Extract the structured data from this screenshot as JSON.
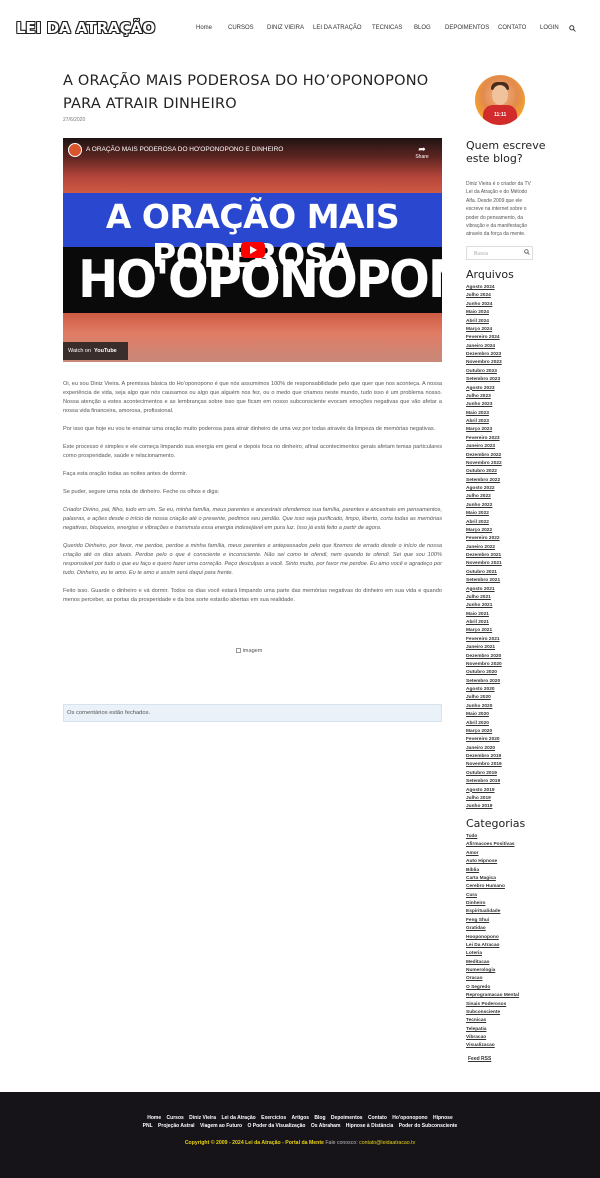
{
  "header": {
    "logo": "LEI DA ATRAÇÃO",
    "nav": [
      "Home",
      "CURSOS",
      "DINIZ VIEIRA",
      "LEI DA ATRAÇÃO",
      "TECNICAS",
      "BLOG",
      "DEPOIMENTOS",
      "CONTATO",
      "LOGIN"
    ]
  },
  "post": {
    "title": "A ORAÇÃO MAIS PODEROSA DO HO’OPONOPONO PARA ATRAIR DINHEIRO",
    "date": "27/6/2020",
    "video": {
      "title": "A ORAÇÃO MAIS PODEROSA DO HO'OPONOPONO E DINHEIRO",
      "share": "Share",
      "line1": "A ORAÇÃO MAIS PODEROSA",
      "line2": "HO'OPONOPONO",
      "watch_on": "Watch on",
      "platform": "YouTube"
    },
    "paragraphs": [
      {
        "text": "Oi, eu sou Diniz Vieira. A premissa básica do Ho’oponopono é que nós assumimos 100% de responsabilidade pelo que quer que nos aconteça. A nossa experiência de vida, seja algo que nós causamos ou algo que alguém nos fez, ou o medo que criamos neste mundo, tudo isso é um problema nosso. Nossa atenção a estes acontecimentos e as lembranças sobre isso que ficam em nosso subconsciente evocam emoções negativas que vão afetar a nossa vida financeira, amorosa, profissional.",
        "italic": false
      },
      {
        "text": "Por isso que hoje eu vou te ensinar uma oração muito poderosa para atrair dinheiro de uma vez por todas através da limpeza de memórias negativas.",
        "italic": false
      },
      {
        "text": "Este processo é simples e ele começa limpando sua energia em geral e depois foca no dinheiro, afinal acontecimentos gerais afetam temas particulares como prosperidade, saúde e relacionamento.",
        "italic": false
      },
      {
        "text": "Faça esta oração todas as noites antes de dormir.",
        "italic": false
      },
      {
        "text": "Se puder, segure uma nota de dinheiro. Feche os olhos e diga:",
        "italic": false
      },
      {
        "text": "Criador Divino, pai, filho, tudo em um. Se eu, minha família, meus parentes e ancestrais ofendemos sua família, parentes e ancestrais em pensamentos, palavras, e ações desde o início de nossa criação até o presente, pedimos seu perdão. Que isso seja purificado, limpo, liberto, corta todas as memórias negativas, bloqueios, energias e vibrações e transmuta essa energia indesejável em pura luz. Isso já está feito a partir de agora.",
        "italic": true
      },
      {
        "text": "Querido Dinheiro, por favor, me perdoe, perdoe a minha família, meus parentes e antepassados pelo que fizemos de errado desde o início de nossa criação até os dias atuais. Perdoe pelo o que é consciente e inconsciente. Não sei como te ofendi, nem quando te ofendi. Sei que sou 100% responsável por tudo o que eu faço e quero fazer uma correção. Peço desculpas a você. Sinto muito, por favor me perdoe. Eu amo você e agradeço por tudo. Dinheiro, eu te amo. Eu te amo e assim será daqui para frente.",
        "italic": true
      },
      {
        "text": "Feito isso. Guarde o dinheiro e vá dormir. Todos os dias você estará limpando uma parte das memórias negativas do dinheiro em sua vida e quando menos perceber, as portas da prosperidade e da boa sorte estarão abertas em sua realidade.",
        "italic": false
      }
    ],
    "image_alt": "imagem",
    "comments_closed": "Os comentários estão fechados."
  },
  "sidebar": {
    "avatar_text": "11:11",
    "who_title": "Quem escreve este blog?",
    "who_text": "Diniz Vieira é o criador da TV Lei da Atração e do Método Alfa. Desde 2009 que ele escreve na internet sobre o poder do pensamento, da vibração e da manifestação através da força da mente.",
    "search_placeholder": "Busca",
    "archives_title": "Arquivos",
    "archives": [
      "Agosto 2024",
      "Julho 2024",
      "Junho 2024",
      "Maio 2024",
      "Abril 2024",
      "Março 2024",
      "Fevereiro 2024",
      "Janeiro 2024",
      "Dezembro 2023",
      "Novembro 2023",
      "Outubro 2023",
      "Setembro 2023",
      "Agosto 2023",
      "Julho 2023",
      "Junho 2023",
      "Maio 2023",
      "Abril 2023",
      "Março 2023",
      "Fevereiro 2023",
      "Janeiro 2023",
      "Dezembro 2022",
      "Novembro 2022",
      "Outubro 2022",
      "Setembro 2022",
      "Agosto 2022",
      "Julho 2022",
      "Junho 2022",
      "Maio 2022",
      "Abril 2022",
      "Março 2022",
      "Fevereiro 2022",
      "Janeiro 2022",
      "Dezembro 2021",
      "Novembro 2021",
      "Outubro 2021",
      "Setembro 2021",
      "Agosto 2021",
      "Julho 2021",
      "Junho 2021",
      "Maio 2021",
      "Abril 2021",
      "Março 2021",
      "Fevereiro 2021",
      "Janeiro 2021",
      "Dezembro 2020",
      "Novembro 2020",
      "Outubro 2020",
      "Setembro 2020",
      "Agosto 2020",
      "Julho 2020",
      "Junho 2020",
      "Maio 2020",
      "Abril 2020",
      "Março 2020",
      "Fevereiro 2020",
      "Janeiro 2020",
      "Dezembro 2019",
      "Novembro 2019",
      "Outubro 2019",
      "Setembro 2019",
      "Agosto 2019",
      "Julho 2019",
      "Junho 2019"
    ],
    "categories_title": "Categorias",
    "categories": [
      "Tudo",
      "Afirmacoes Positivas",
      "Amor",
      "Auto Hipnose",
      "Bíblia",
      "Carta Magica",
      "Cerebro Humano",
      "Cura",
      "Dinheiro",
      "Espiritualidade",
      "Feng Shui",
      "Gratidao",
      "Hooponopono",
      "Lei Da Atracao",
      "Loteria",
      "Meditacao",
      "Numerologia",
      "Oracao",
      "O Segredo",
      "Reprogramacao Mental",
      "Sinais Poderosos",
      "Subconsciente",
      "Tecnicas",
      "Telepatia",
      "Vibracao",
      "Visualizacao"
    ],
    "feed": "Feed RSS"
  },
  "footer": {
    "row1": [
      "Home",
      "Cursos",
      "Diniz Vieira",
      "Lei da Atração",
      "Exercícios",
      "Artigos",
      "Blog",
      "Depoimentos",
      "Contato",
      "Ho'oponopono",
      "Hipnose"
    ],
    "row2": [
      "PNL",
      "Projeção Astral",
      "Viagem ao Futuro",
      "O Poder da Visualização",
      "Os Abraham",
      "Hipnose à Distância",
      "Poder do Subconsciente"
    ],
    "copyright": "Copyright © 2009 - 2024 Lei da Atração - Portal da Mente",
    "contact_label": "Fale conosco:",
    "contact_email": "contato@leidaatracao.tv"
  }
}
